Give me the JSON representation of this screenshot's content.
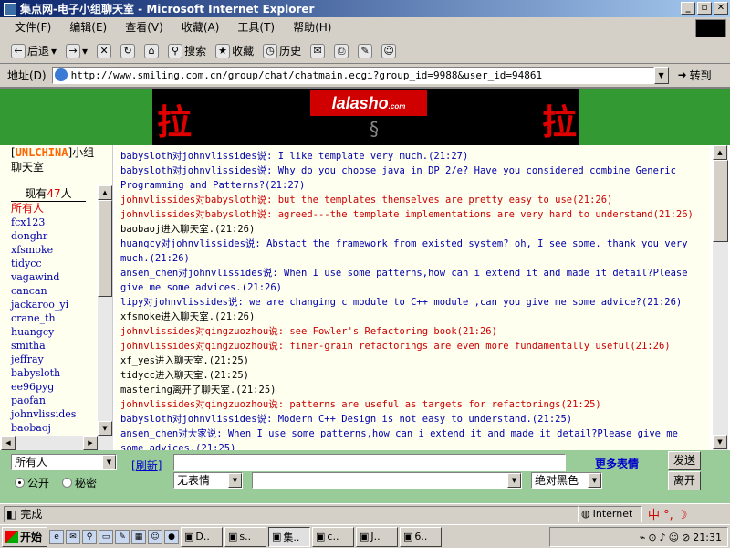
{
  "window": {
    "title": "集点网-电子小组聊天室 - Microsoft Internet Explorer"
  },
  "menu": [
    "文件(F)",
    "编辑(E)",
    "查看(V)",
    "收藏(A)",
    "工具(T)",
    "帮助(H)"
  ],
  "toolbar": {
    "back": "后退",
    "search": "搜索",
    "favorites": "收藏",
    "history": "历史"
  },
  "address": {
    "label": "地址(D)",
    "url": "http://www.smiling.com.cn/group/chat/chatmain.ecgi?group_id=9988&user_id=94861",
    "go": "转到"
  },
  "banner": {
    "left_char": "拉",
    "right_char": "拉",
    "logo": "lalasho",
    "logo_suffix": ".com"
  },
  "sidebar": {
    "group_open": "[",
    "group_name": "UNLCHINA",
    "group_close": "]小组聊天室",
    "count_prefix": "现有",
    "count": "47",
    "count_suffix": "人",
    "users": [
      "所有人",
      "fcx123",
      "donghr",
      "xfsmoke",
      "tidycc",
      "vagawind",
      "cancan",
      "jackaroo_yi",
      "crane_th",
      "huangcy",
      "smitha",
      "jeffray",
      "babysloth",
      "ee96pyg",
      "paofan",
      "johnvlissides",
      "baobaoj"
    ]
  },
  "messages": [
    {
      "text": "babysloth对johnvlissides说: I like template very much.(21:27)",
      "color": "blue"
    },
    {
      "text": "babysloth对johnvlissides说: Why do you choose java in DP 2/e? Have you considered combine Generic Programming and Patterns?(21:27)",
      "color": "blue"
    },
    {
      "text": "johnvlissides对babysloth说: but the templates themselves are pretty easy to use(21:26)",
      "color": "red"
    },
    {
      "text": "johnvlissides对babysloth说: agreed---the template implementations are very hard to understand(21:26)",
      "color": "red"
    },
    {
      "text": "baobaoj进入聊天室.(21:26)",
      "color": "black"
    },
    {
      "text": "huangcy对johnvlissides说: Abstact the framework from existed system? oh, I see some. thank you very much.(21:26)",
      "color": "blue"
    },
    {
      "text": "ansen_chen对johnvlissides说: When I use some patterns,how can i extend it and made it detail?Please give me some advices.(21:26)",
      "color": "blue"
    },
    {
      "text": "lipy对johnvlissides说: we are changing c module to C++ module ,can you give me some advice?(21:26)",
      "color": "blue"
    },
    {
      "text": "xfsmoke进入聊天室.(21:26)",
      "color": "black"
    },
    {
      "text": "johnvlissides对qingzuozhou说: see Fowler's Refactoring book(21:26)",
      "color": "red"
    },
    {
      "text": "johnvlissides对qingzuozhou说: finer-grain refactorings are even more fundamentally useful(21:26)",
      "color": "red"
    },
    {
      "text": "xf_yes进入聊天室.(21:25)",
      "color": "black"
    },
    {
      "text": "tidycc进入聊天室.(21:25)",
      "color": "black"
    },
    {
      "text": "mastering离开了聊天室.(21:25)",
      "color": "black"
    },
    {
      "text": "johnvlissides对qingzuozhou说: patterns are useful as targets for refactorings(21:25)",
      "color": "red"
    },
    {
      "text": "babysloth对johnvlissides说: Modern C++ Design is not easy to understand.(21:25)",
      "color": "blue"
    },
    {
      "text": "ansen_chen对大家说: When I use some patterns,how can i extend it and made it detail?Please give me some advices.(21:25)",
      "color": "blue"
    }
  ],
  "bottom": {
    "recipient": "所有人",
    "refresh": "刷新",
    "message_value": "",
    "more_expr": "更多表情",
    "send": "发送",
    "leave": "离开",
    "public": "公开",
    "private": "秘密",
    "expression": "无表情",
    "action_value": "",
    "color_select": "绝对黑色"
  },
  "status": {
    "text": "完成",
    "zone": "Internet"
  },
  "taskbar": {
    "start": "开始",
    "tasks": [
      "D..",
      "s..",
      "集..",
      "c..",
      "J..",
      "6.."
    ],
    "clock": "21:31"
  },
  "colors": {
    "banner_green": "#339933",
    "bottom_green": "#99cc99",
    "chat_bg": "#fffff0",
    "msg_blue": "#0000aa",
    "msg_red": "#cc0000"
  }
}
